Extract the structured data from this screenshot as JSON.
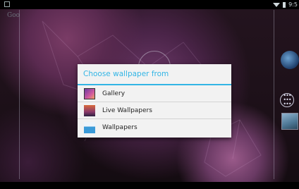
{
  "status_bar": {
    "time": "9:5",
    "icons": [
      "notification-icon",
      "wifi-icon",
      "battery-icon"
    ]
  },
  "home": {
    "search_hint": "Goo"
  },
  "dialog": {
    "title": "Choose wallpaper from",
    "accent_color": "#33b5e5",
    "options": [
      {
        "label": "Gallery",
        "icon": "gallery-icon"
      },
      {
        "label": "Live Wallpapers",
        "icon": "live-wallpapers-icon"
      },
      {
        "label": "Wallpapers",
        "icon": "wallpapers-icon"
      }
    ]
  },
  "dock": {
    "icons": [
      "globe-icon",
      "all-apps-icon",
      "photo-icon"
    ]
  }
}
